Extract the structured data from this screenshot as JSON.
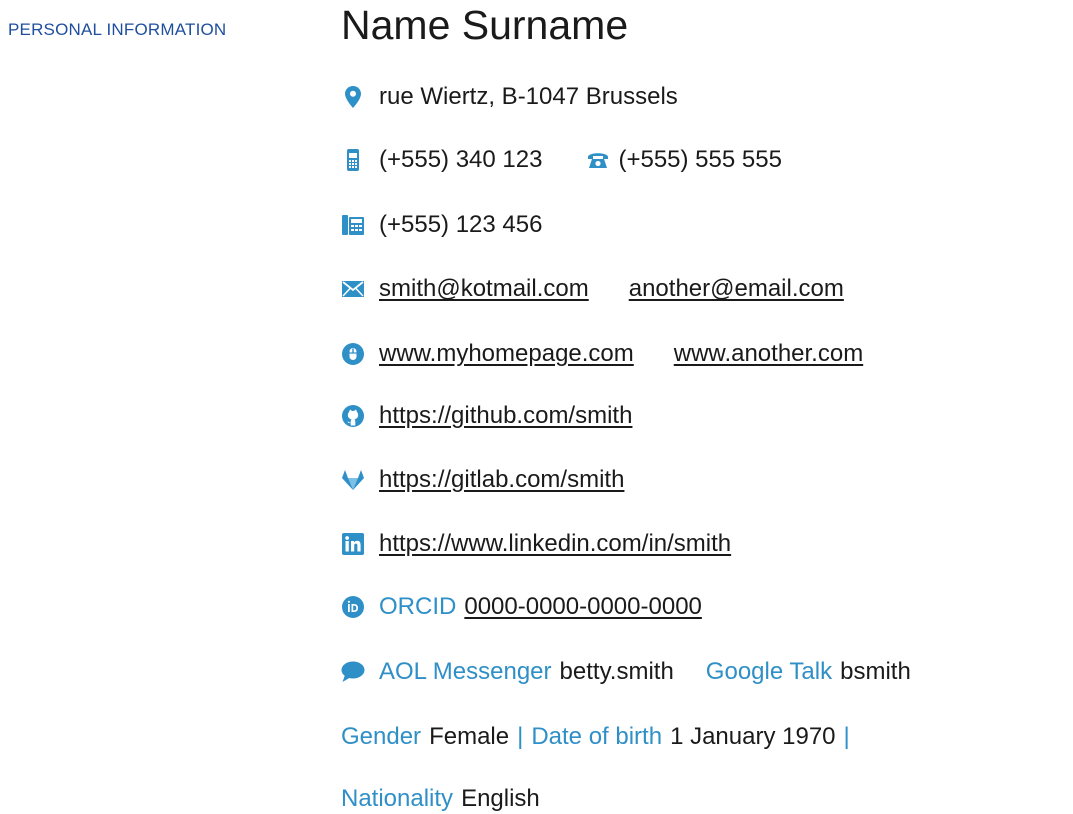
{
  "section_label": "PERSONAL INFORMATION",
  "name": "Name Surname",
  "address": "rue Wiertz, B-1047 Brussels",
  "phones": {
    "mobile": "(+555) 340 123",
    "home": "(+555) 555 555",
    "fax": "(+555) 123 456"
  },
  "emails": [
    "smith@kotmail.com",
    "another@email.com"
  ],
  "websites": [
    "www.myhomepage.com",
    "www.another.com"
  ],
  "github": "https://github.com/smith",
  "gitlab": "https://gitlab.com/smith",
  "linkedin": "https://www.linkedin.com/in/smith",
  "orcid": {
    "label": "ORCID",
    "value": "0000-0000-0000-0000"
  },
  "messengers": [
    {
      "label": "AOL Messenger",
      "value": "betty.smith"
    },
    {
      "label": "Google Talk",
      "value": "bsmith"
    }
  ],
  "personal": {
    "gender_label": "Gender",
    "gender": "Female",
    "birth_label": "Date of birth",
    "birth": "1 January 1970",
    "separator": "|",
    "nationality_label": "Nationality",
    "nationality": "English"
  },
  "colors": {
    "label_blue": "#2f8fc7",
    "section_blue": "#1f4e9e",
    "icon_blue": "#2f8fc7"
  },
  "icons": [
    "map-marker-icon",
    "mobile-phone-icon",
    "phone-icon",
    "fax-icon",
    "envelope-icon",
    "mouse-globe-icon",
    "github-icon",
    "gitlab-icon",
    "linkedin-icon",
    "orcid-icon",
    "speech-bubble-icon"
  ]
}
